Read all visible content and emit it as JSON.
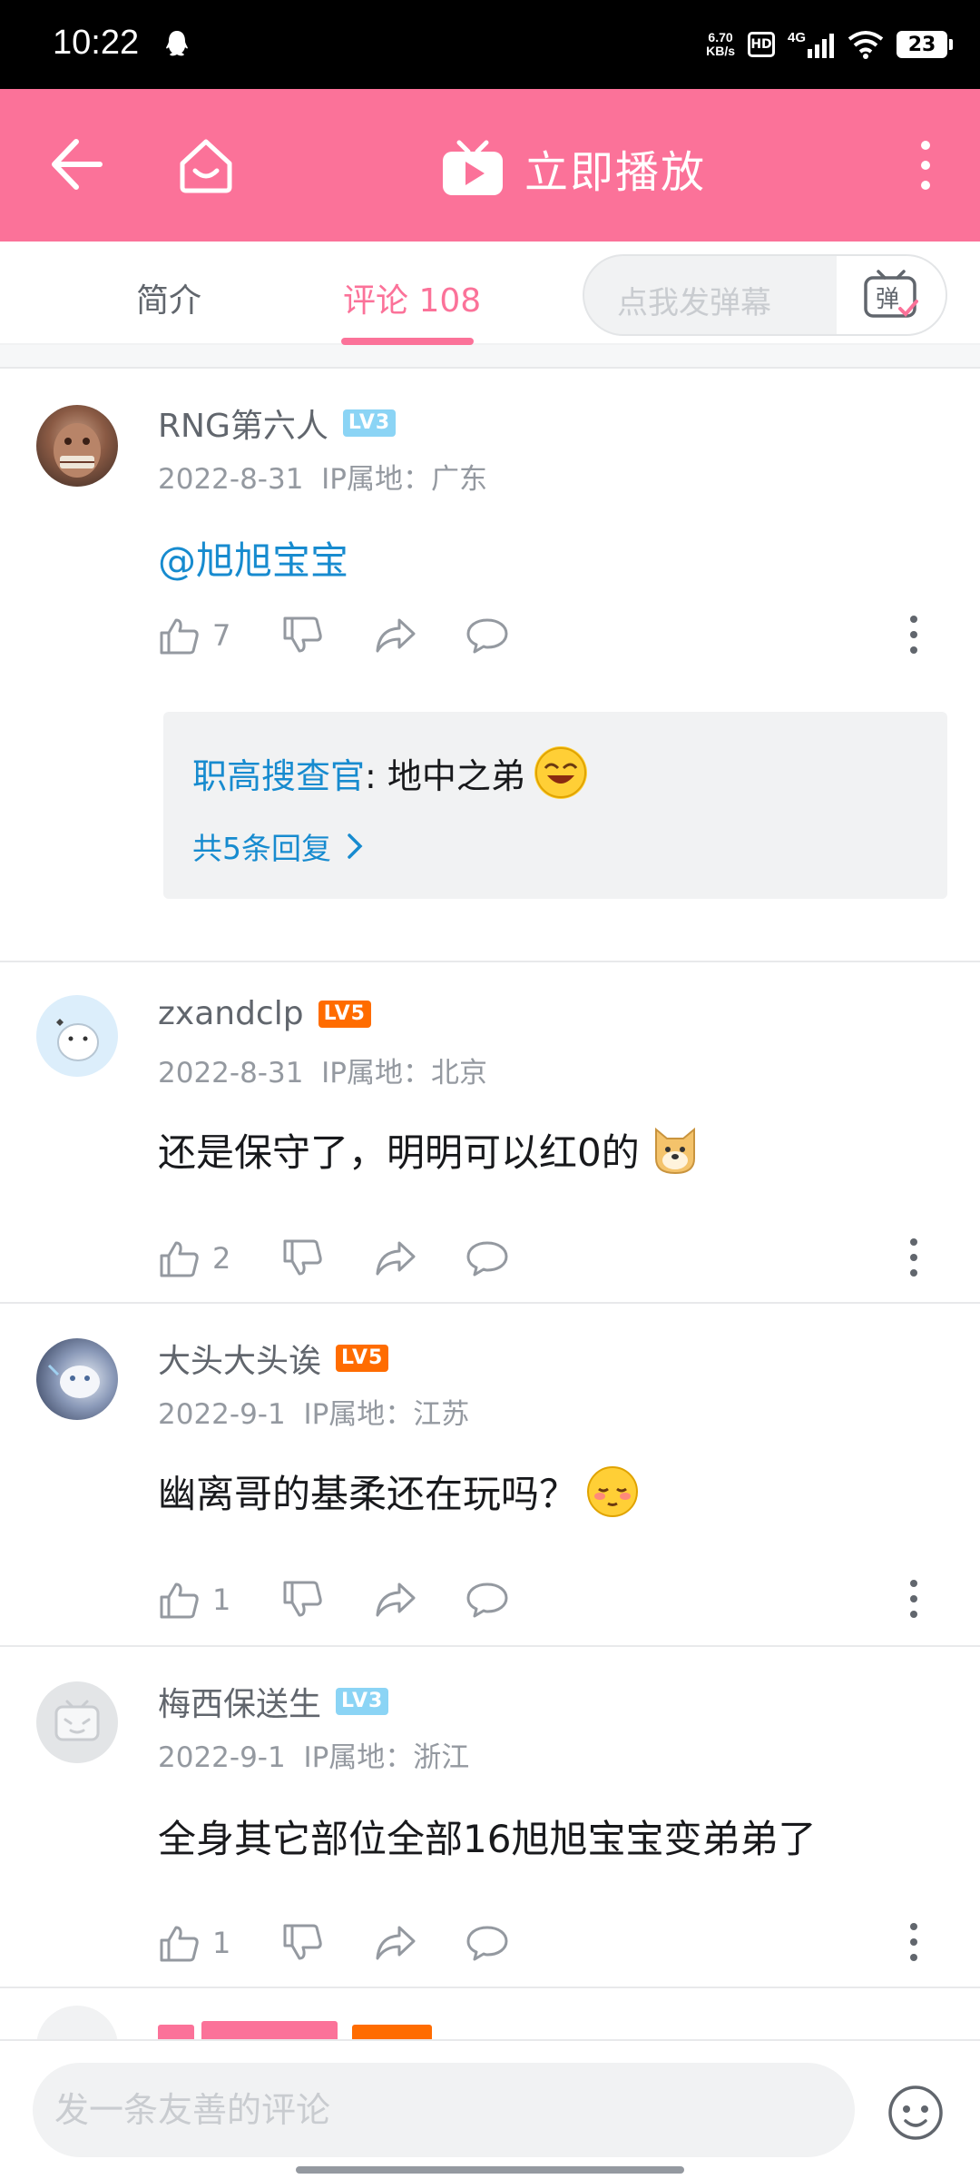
{
  "status_bar": {
    "time": "10:22",
    "speed_value": "6.70",
    "speed_unit": "KB/s",
    "hd_badge": "HD",
    "network": "4G",
    "battery": "23"
  },
  "header": {
    "play_label": "立即播放",
    "accent_color": "#fb7299"
  },
  "tabs": {
    "intro": "简介",
    "comments": "评论 108",
    "danmaku_placeholder": "点我发弹幕",
    "danmaku_button": "弹"
  },
  "comments": [
    {
      "user": "RNG第六人",
      "level": "LV3",
      "date": "2022-8-31",
      "ip": "IP属地：广东",
      "text": "@旭旭宝宝",
      "likes": "7",
      "replies": {
        "user": "职高搜查官",
        "text": ": 地中之弟",
        "more": "共5条回复"
      }
    },
    {
      "user": "zxandclp",
      "level": "LV5",
      "date": "2022-8-31",
      "ip": "IP属地：北京",
      "text": "还是保守了，明明可以红0的",
      "likes": "2"
    },
    {
      "user": "大头大头诶",
      "level": "LV5",
      "date": "2022-9-1",
      "ip": "IP属地：江苏",
      "text": "幽离哥的基柔还在玩吗？",
      "likes": "1"
    },
    {
      "user": "梅西保送生",
      "level": "LV3",
      "date": "2022-9-1",
      "ip": "IP属地：浙江",
      "text": "全身其它部位全部16旭旭宝宝变弟弟了",
      "likes": "1"
    }
  ],
  "bottom": {
    "comment_placeholder": "发一条友善的评论"
  }
}
